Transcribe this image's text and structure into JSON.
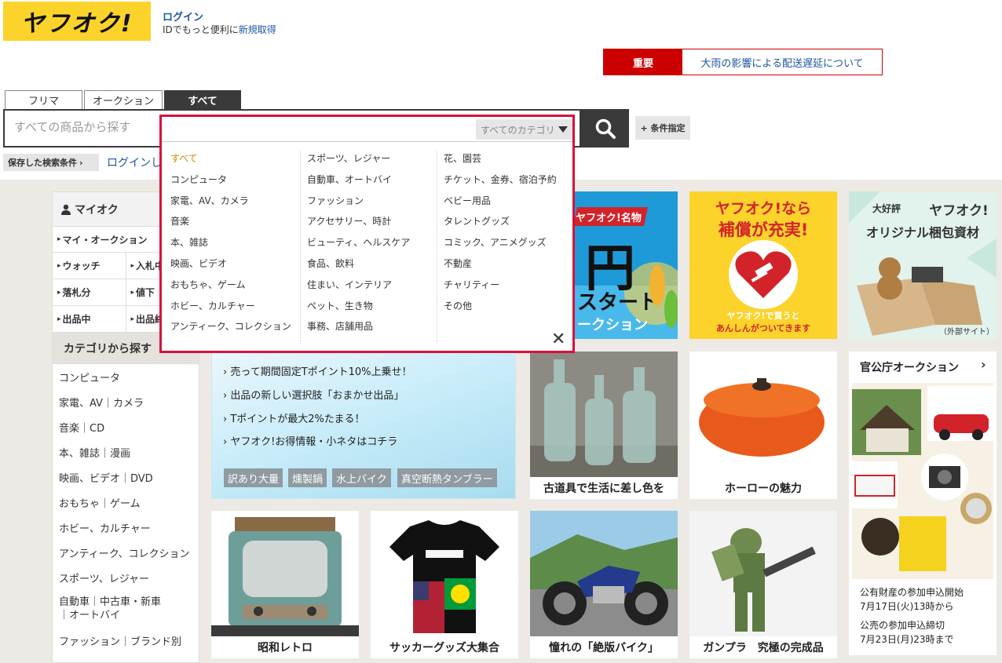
{
  "header": {
    "logo_text": "ヤフオク!",
    "login_label": "ログイン",
    "id_note": "IDでもっと便利に",
    "register_label": "新規取得"
  },
  "notice": {
    "label": "重要",
    "text": "大雨の影響による配送遅延について"
  },
  "search": {
    "tabs": [
      "フリマ",
      "オークション",
      "すべて"
    ],
    "placeholder": "すべての商品から探す",
    "conditions_label": "+ 条件指定",
    "saved_label": "保存した検索条件",
    "saved_login": "ログインし"
  },
  "dropdown": {
    "selected": "すべてのカテゴリ",
    "columns": [
      [
        "すべて",
        "コンピュータ",
        "家電、AV、カメラ",
        "音楽",
        "本、雑誌",
        "映画、ビデオ",
        "おもちゃ、ゲーム",
        "ホビー、カルチャー",
        "アンティーク、コレクション"
      ],
      [
        "スポーツ、レジャー",
        "自動車、オートバイ",
        "ファッション",
        "アクセサリー、時計",
        "ビューティ、ヘルスケア",
        "食品、飲料",
        "住まい、インテリア",
        "ペット、生き物",
        "事務、店舗用品"
      ],
      [
        "花、園芸",
        "チケット、金券、宿泊予約",
        "ベビー用品",
        "タレントグッズ",
        "コミック、アニメグッズ",
        "不動産",
        "チャリティー",
        "その他"
      ]
    ]
  },
  "sidebar": {
    "myauction_title": "マイオク",
    "my_auction": "マイ・オークション",
    "rows": [
      [
        "ウォッチ",
        "入札中"
      ],
      [
        "落札分",
        "値下"
      ],
      [
        "出品中",
        "出品終"
      ]
    ],
    "category_title": "カテゴリから探す",
    "categories": [
      "コンピュータ",
      "家電、AV｜カメラ",
      "音楽｜CD",
      "本、雑誌｜漫画",
      "映画、ビデオ｜DVD",
      "おもちゃ｜ゲーム",
      "ホビー、カルチャー",
      "アンティーク、コレクション",
      "スポーツ、レジャー",
      "自動車｜中古車・新車｜オートバイ",
      "ファッション｜ブランド別"
    ]
  },
  "banners": {
    "yen_start": {
      "badge": "ヤフオク!名物",
      "big": "円",
      "line1": "スタート",
      "line2": "ークション"
    },
    "hosho": {
      "line1": "ヤフオク!なら",
      "line2": "補償が充実!",
      "sub1": "ヤフオク!で買うと",
      "sub2": "あんしんがついてきます"
    },
    "konpo": {
      "tag": "大好評",
      "line1": "ヤフオク!",
      "line2": "オリジナル梱包資材",
      "note": "（外部サイト）"
    }
  },
  "promo": {
    "lines": [
      "売って期間固定Tポイント10%上乗せ！",
      "出品の新しい選択肢「おまかせ出品」",
      "Tポイントが最大2%たまる！",
      "ヤフオク!お得情報・小ネタはコチラ"
    ],
    "keywords": [
      "訳あり大量",
      "燻製鍋",
      "水上バイク",
      "真空断熱タンブラー"
    ]
  },
  "tiles": {
    "bottles": "古道具で生活に差し色を",
    "pot": "ホーローの魅力",
    "retro": "昭和レトロ",
    "soccer": "サッカーグッズ大集合",
    "bike": "憧れの「絶版バイク」",
    "gunpla": "ガンプラ　究極の完成品"
  },
  "government": {
    "title": "官公庁オークション",
    "line1": "公有財産の参加申込開始",
    "line2": "7月17日(火)13時から",
    "line3": "公売の参加申込締切",
    "line4": "7月23日(月)23時まで"
  },
  "colors": {
    "brand_yellow": "#fbd32a",
    "alert_red": "#cc0000",
    "dropdown_border": "#d9103a",
    "link_blue": "#1c57a3",
    "search_dark": "#3a3a3a"
  }
}
